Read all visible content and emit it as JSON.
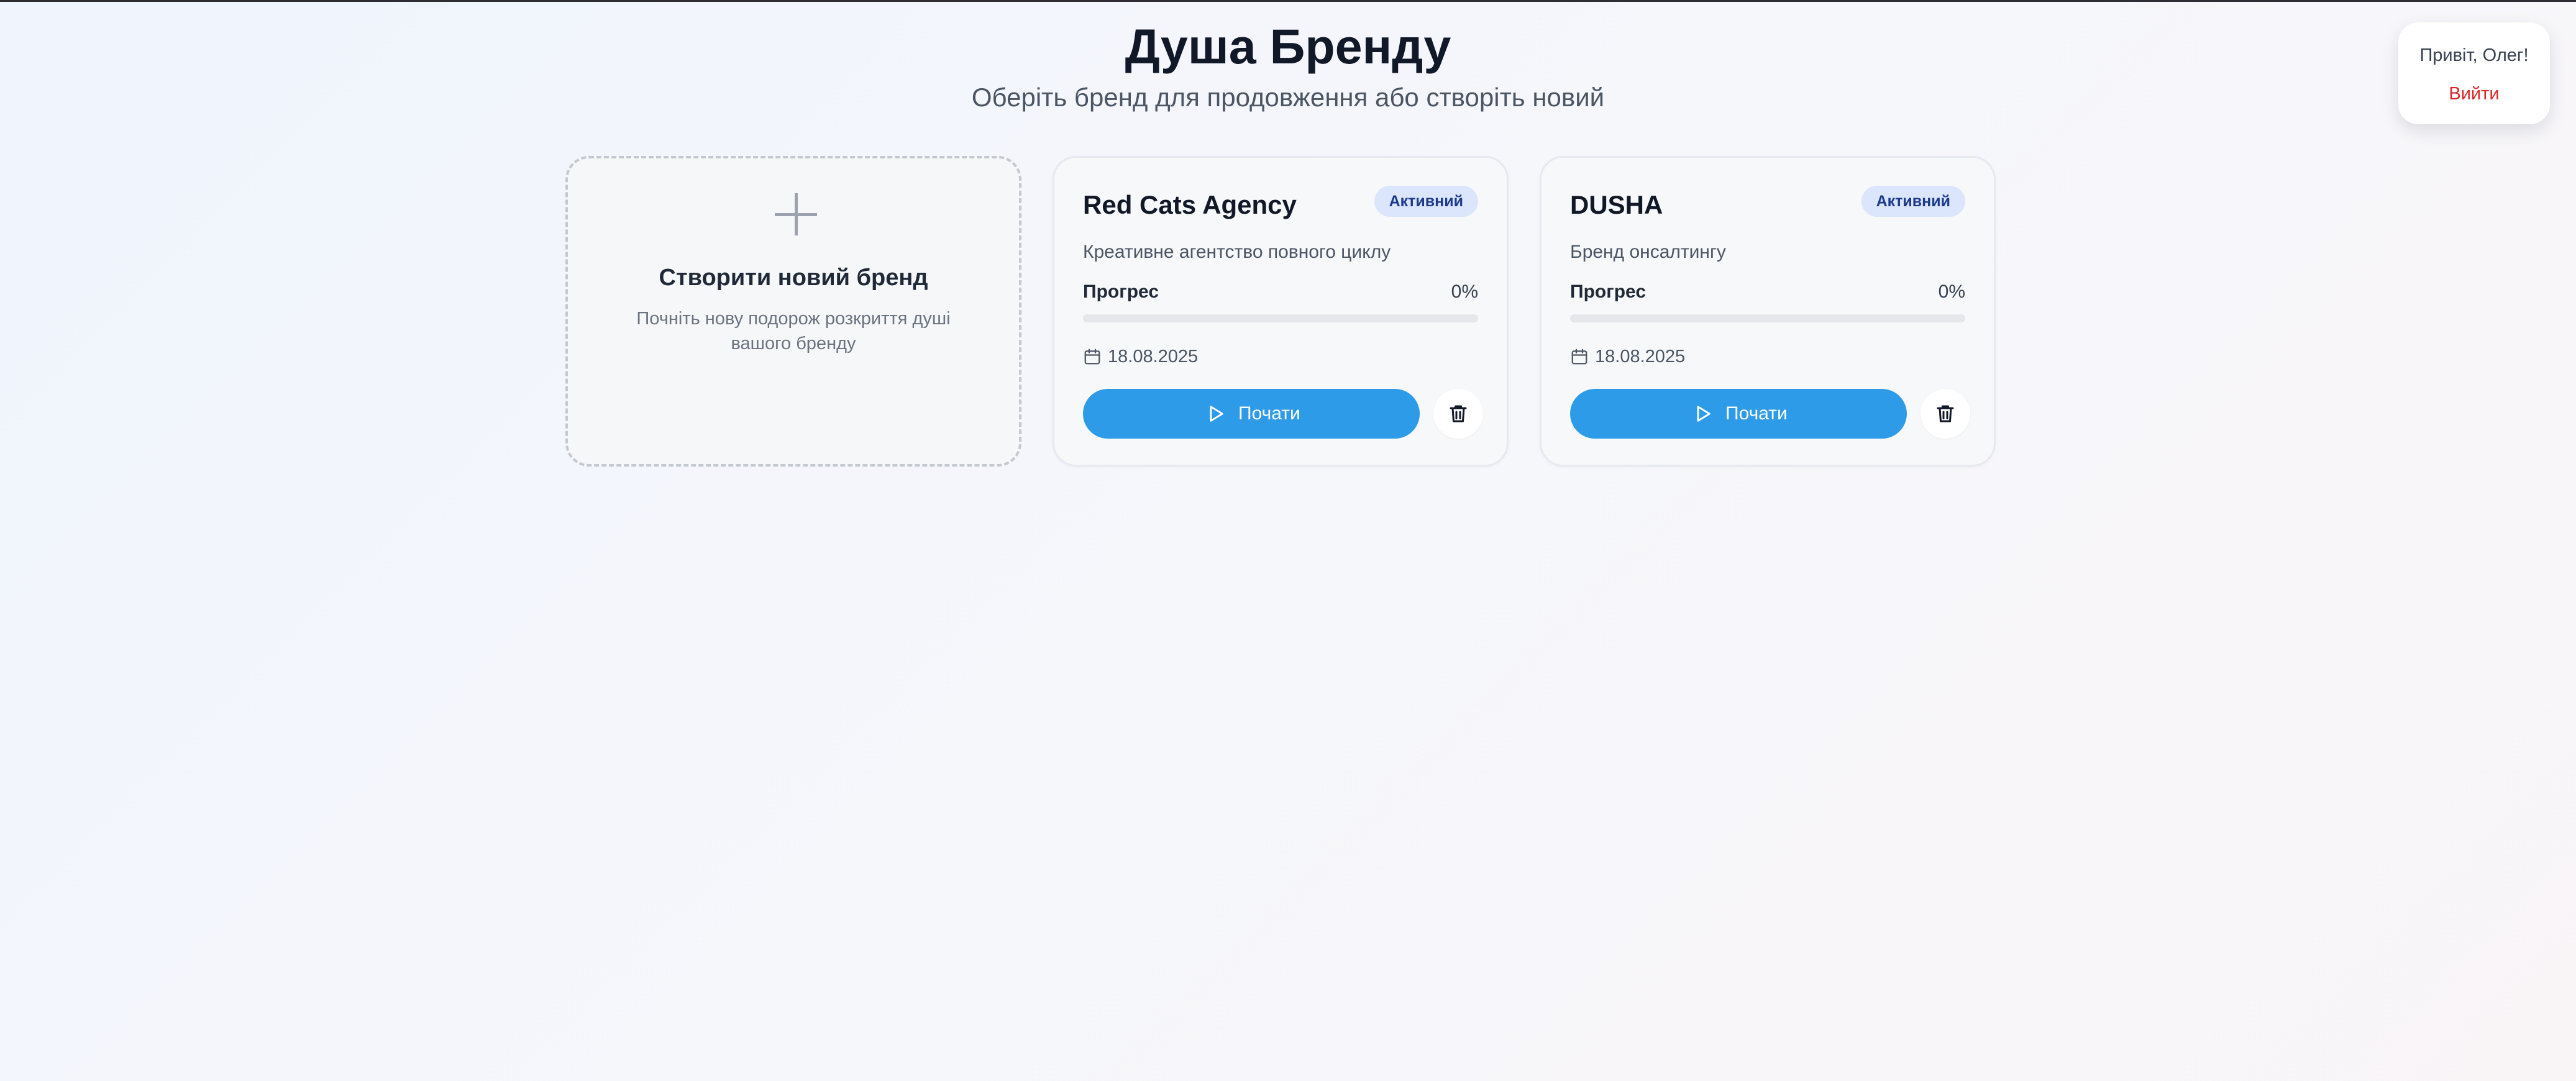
{
  "header": {
    "title": "Душа Бренду",
    "subtitle": "Оберіть бренд для продовження або створіть новий"
  },
  "user": {
    "greeting": "Привіт, Олег!",
    "logout_label": "Вийти"
  },
  "create_card": {
    "icon": "plus-icon",
    "title": "Створити новий бренд",
    "description": "Почніть нову подорож розкриття душі вашого бренду"
  },
  "brands": [
    {
      "name": "Red Cats Agency",
      "status": "Активний",
      "description": "Креативне агентство повного циклу",
      "progress_label": "Прогрес",
      "progress_text": "0%",
      "progress": 0,
      "date": "18.08.2025",
      "start_label": "Почати"
    },
    {
      "name": "DUSHA",
      "status": "Активний",
      "description": "Бренд онсалтингу",
      "progress_label": "Прогрес",
      "progress_text": "0%",
      "progress": 0,
      "date": "18.08.2025",
      "start_label": "Почати"
    }
  ],
  "icons": {
    "calendar": "calendar-icon",
    "start": "play-icon",
    "delete": "trash-icon"
  },
  "colors": {
    "accent": "#2e9be8",
    "logout": "#dc2626",
    "badge_bg": "#dbe5fb",
    "badge_text": "#1e3a8a",
    "title": "#111827"
  }
}
